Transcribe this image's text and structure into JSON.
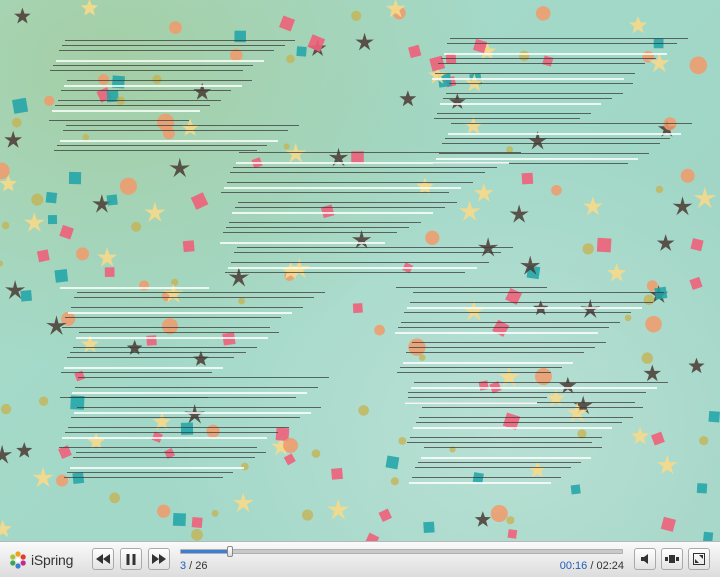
{
  "player": {
    "logo_text": "iSpring",
    "slide_current": "3",
    "slide_sep": " / ",
    "slide_total": "26",
    "time_current": "00:16",
    "time_sep": " / ",
    "time_total": "02:24",
    "progress_fraction": 0.111,
    "accent_color": "#3d7fd6",
    "icons": [
      "rewind-icon",
      "pause-icon",
      "fast-forward-icon",
      "volume-icon",
      "layout-icon",
      "fullscreen-icon"
    ]
  }
}
